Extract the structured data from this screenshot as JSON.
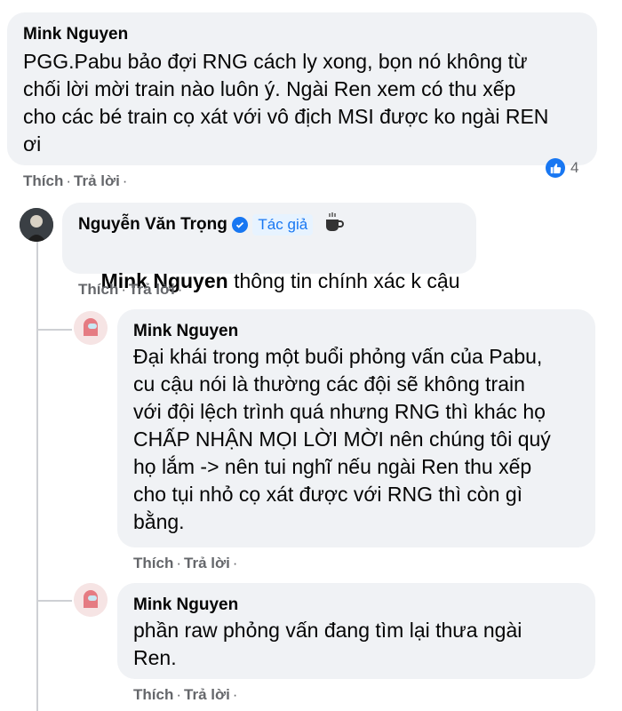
{
  "comments": [
    {
      "author": "Mink Nguyen",
      "text": "PGG.Pabu bảo đợi RNG cách ly xong, bọn nó không từ\nchối lời mời train nào luôn ý. Ngài Ren xem có thu xếp\ncho các bé train cọ xát với vô địch MSI được ko ngài REN\nơi",
      "like_label": "Thích",
      "reply_label": "Trả lời",
      "reaction_count": "4"
    },
    {
      "author": "Nguyễn Văn Trọng",
      "author_badge": "Tác giả",
      "mention": "Mink Nguyen",
      "text": "thông tin chính xác k cậu",
      "like_label": "Thích",
      "reply_label": "Trả lời"
    },
    {
      "author": "Mink Nguyen",
      "text": "Đại khái trong một buổi phỏng vấn của Pabu,\ncu cậu nói là thường các đội sẽ không train\nvới đội lệch trình quá nhưng RNG thì khác họ\nCHẤP NHẬN MỌI LỜI MỜI nên chúng tôi quý\nhọ lắm -> nên tui nghĩ nếu ngài Ren thu xếp\ncho tụi nhỏ cọ xát được với RNG thì còn gì\nbằng.",
      "like_label": "Thích",
      "reply_label": "Trả lời"
    },
    {
      "author": "Mink Nguyen",
      "text": "phần raw phỏng vấn đang tìm lại thưa ngài\nRen.",
      "like_label": "Thích",
      "reply_label": "Trả lời"
    }
  ],
  "colors": {
    "bubble": "#f0f2f5",
    "action_text": "#65676b",
    "accent": "#1877f2",
    "thread_line": "#ced0d4"
  },
  "icons": {
    "reaction": "like-icon",
    "verified": "verified-badge-icon",
    "special": "coffee-cup-icon"
  }
}
